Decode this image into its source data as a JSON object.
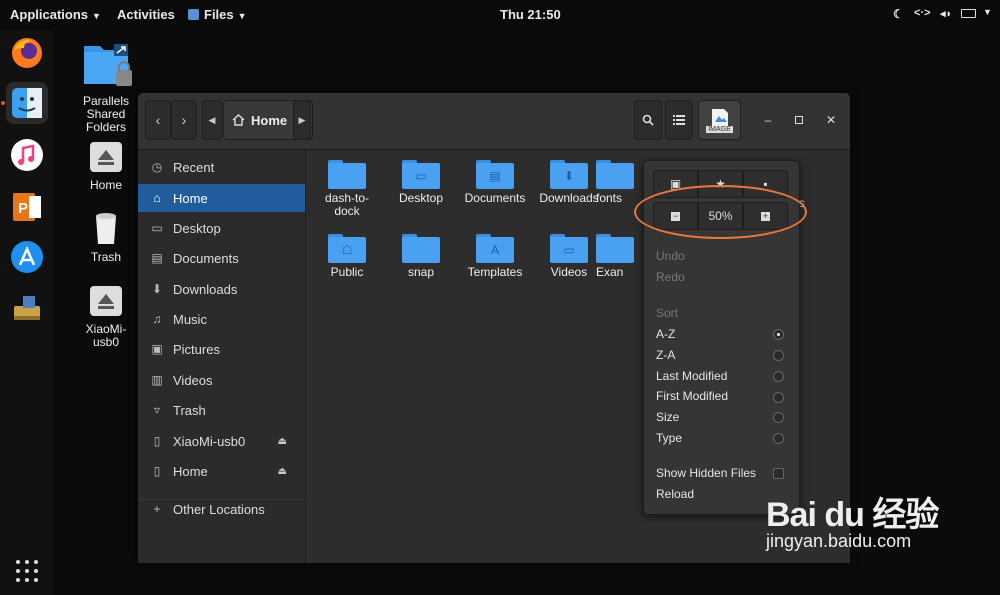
{
  "topbar": {
    "applications": "Applications",
    "activities": "Activities",
    "files_menu": "Files",
    "clock": "Thu 21:50"
  },
  "dock": {
    "items": [
      "firefox-icon",
      "finder-icon",
      "music-icon",
      "presentation-icon",
      "app-store-icon",
      "usb-drive-icon",
      "show-apps-icon"
    ]
  },
  "desktop": {
    "icons": [
      {
        "label": "Parallels\nShared\nFolders"
      },
      {
        "label": "Home"
      },
      {
        "label": "Trash"
      },
      {
        "label": "XiaoMi-\nusb0"
      }
    ]
  },
  "header": {
    "breadcrumb": "Home",
    "preview_label": "IMAGE"
  },
  "sidebar": {
    "items": [
      {
        "label": "Recent"
      },
      {
        "label": "Home"
      },
      {
        "label": "Desktop"
      },
      {
        "label": "Documents"
      },
      {
        "label": "Downloads"
      },
      {
        "label": "Music"
      },
      {
        "label": "Pictures"
      },
      {
        "label": "Videos"
      },
      {
        "label": "Trash"
      },
      {
        "label": "XiaoMi-usb0"
      },
      {
        "label": "Home"
      },
      {
        "label": "Other Locations"
      }
    ]
  },
  "files": {
    "items": [
      {
        "label": "dash-to-\ndock"
      },
      {
        "label": "Desktop"
      },
      {
        "label": "Documents"
      },
      {
        "label": "Downloads"
      },
      {
        "label": "fonts"
      },
      {
        "label": "res"
      },
      {
        "label": "Public"
      },
      {
        "label": "snap"
      },
      {
        "label": "Templates"
      },
      {
        "label": "Videos"
      },
      {
        "label": "Exan"
      }
    ]
  },
  "popover": {
    "zoom": "50%",
    "undo": "Undo",
    "redo": "Redo",
    "sort_heading": "Sort",
    "sort_options": [
      {
        "label": "A-Z",
        "selected": true
      },
      {
        "label": "Z-A",
        "selected": false
      },
      {
        "label": "Last Modified",
        "selected": false
      },
      {
        "label": "First Modified",
        "selected": false
      },
      {
        "label": "Size",
        "selected": false
      },
      {
        "label": "Type",
        "selected": false
      }
    ],
    "show_hidden": "Show Hidden Files",
    "reload": "Reload"
  },
  "watermark": {
    "brand": "Bai du 经验",
    "url": "jingyan.baidu.com"
  },
  "colors": {
    "accent": "#215d9c",
    "folder": "#4aa1f2",
    "highlight_oval": "#e8793a"
  }
}
